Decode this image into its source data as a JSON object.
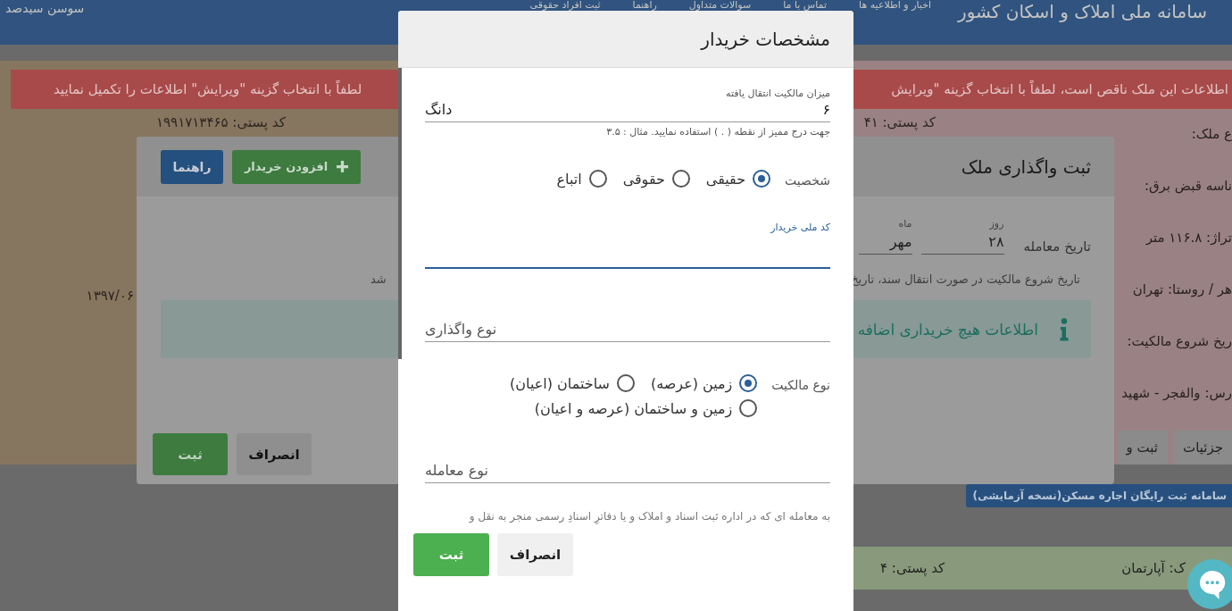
{
  "header": {
    "title": "سامانه ملی املاک و اسکان کشور",
    "nav": [
      "اخبار و اطلاعیه ها",
      "تماس با ما",
      "سوالات متداول",
      "راهنما",
      "ثبت افراد حقوقی"
    ],
    "user": "سوسن سیدصد"
  },
  "page": {
    "alert_right": "اطلاعات این ملک ناقص است، لطفاً با انتخاب گزینه \"ویرایش",
    "alert_left": "لطفاً با انتخاب گزینه \"ویرایش\" اطلاعات را تکمیل نمایید",
    "date_left": "۱۳۹۷/۰۶",
    "postal_left": "کد پستی: ۱۹۹۱۷۱۳۴۶۵",
    "postal_right": "کد پستی: ۴۱",
    "details": [
      "ع ملک:",
      "ناسه قبض برق:",
      "تراژ: ۱۱۶.۸ متر",
      "هر / روستا: تهران",
      "ریخ شروع مالکیت:",
      "رس: والفجر - شهید"
    ],
    "actions": [
      "جزئیات",
      "ثبت و"
    ],
    "rent_button": "سامانه ثبت رایگان اجاره مسکن(نسخه آزمایشی)",
    "row_postal": "کد پستی: ۴",
    "row_type": "ک: آپارتمان"
  },
  "transfer_dialog": {
    "title": "ثبت واگذاری ملک",
    "help_button": "راهنما",
    "add_button": "افزودن خریدار",
    "date_label": "تاریخ معامله",
    "date_fields": [
      {
        "label": "روز",
        "value": "۲۸"
      },
      {
        "label": "ماه",
        "value": "مهر"
      }
    ],
    "note_right": "تاریخ شروع مالکیت در صورت انتقال سند، تاریخ",
    "note_left": "شد",
    "info": "اطلاعات هیچ خریداری اضافه",
    "cancel": "انصراف",
    "submit": "ثبت"
  },
  "buyer_dialog": {
    "title": "مشخصات خریدار",
    "items": [
      {
        "kind": "field",
        "label": "میزان مالکیت انتقال یافته",
        "value": "۶",
        "suffix": "دانگ",
        "hint": "جهت درج ممیز از نقطه ( . ) استفاده نمایید. مثال : ۳.۵",
        "focused": false
      },
      {
        "kind": "radio_group",
        "label": "شخصیت",
        "options": [
          {
            "label": "حقیقی",
            "selected": true
          },
          {
            "label": "حقوقی",
            "selected": false
          },
          {
            "label": "اتباع",
            "selected": false
          }
        ]
      },
      {
        "kind": "field",
        "label": "کد ملی خریدار",
        "focused": true
      },
      {
        "kind": "field",
        "placeholder": "نوع واگذاری",
        "focused": false
      },
      {
        "kind": "radio_group",
        "label": "نوع مالکیت",
        "options": [
          {
            "label": "زمین (عرصه)",
            "selected": true
          },
          {
            "label": "ساختمان (اعیان)",
            "selected": false
          },
          {
            "label": "زمین و ساختمان (عرصه و اعیان)",
            "selected": false
          }
        ]
      },
      {
        "kind": "field",
        "placeholder": "نوع معامله",
        "focused": false
      },
      {
        "kind": "note",
        "text": "به معامله ای که در اداره ثبت اسناد و املاک و یا دفاترِ اسنادِ رسمی منجر به نقل و"
      }
    ],
    "cancel": "انصراف",
    "submit": "ثبت"
  }
}
